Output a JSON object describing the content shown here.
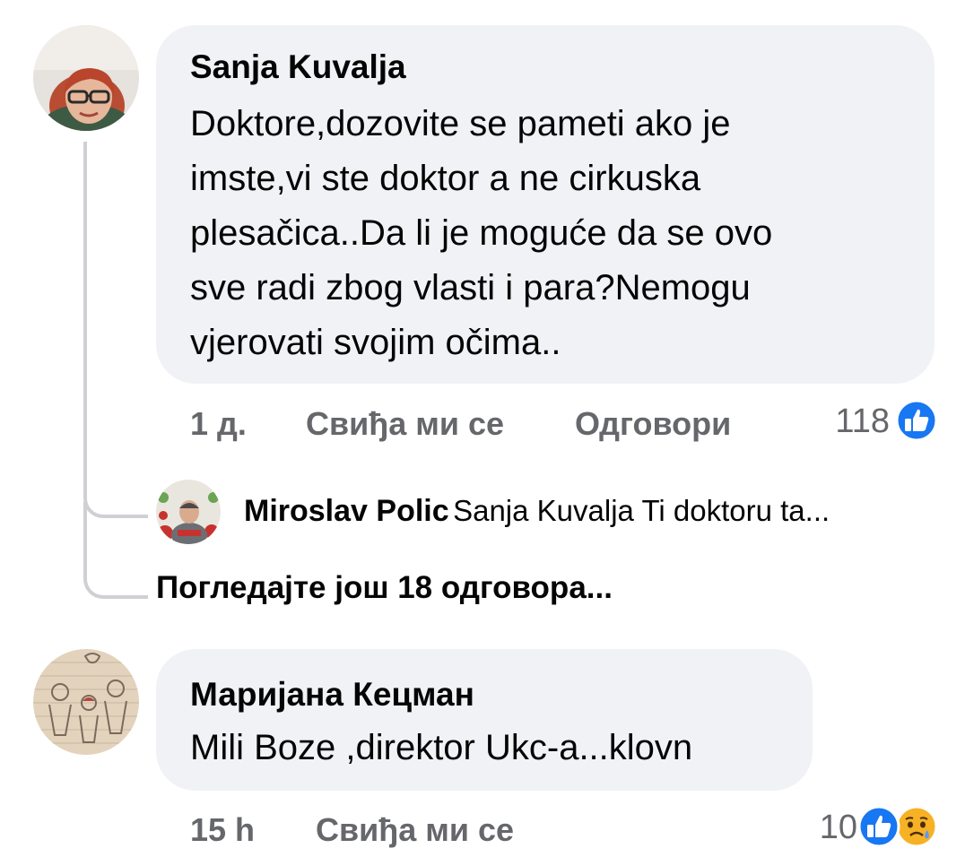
{
  "comments": [
    {
      "author": "Sanja Kuvalja",
      "text_lines": [
        "Doktore,dozovite se pameti ako je",
        "imste,vi ste doktor a ne cirkuska",
        "plesačica..Da li je moguće da se ovo",
        "sve radi zbog vlasti i para?Nemogu",
        "vjerovati svojim očima.."
      ],
      "time": "1 д.",
      "like_label": "Свиђа ми се",
      "reply_label": "Одговори",
      "reaction_count": "118",
      "reactions": [
        "like-icon"
      ]
    },
    {
      "author": "Маријана Кецман",
      "text_lines": [
        "Mili Boze ,direktor Ukc-a...klovn"
      ],
      "time": "15 h",
      "like_label": "Свиђа ми се",
      "reaction_count": "10",
      "reactions": [
        "like-icon",
        "sad-icon"
      ]
    }
  ],
  "reply_preview": {
    "author": "Miroslav Polic",
    "text": "Sanja Kuvalja Ti doktoru ta..."
  },
  "view_more_replies": "Погледајте још 18 одговора...",
  "colors": {
    "bubble": "#f0f2f5",
    "meta_text": "#65676b",
    "like_blue": "#1877f2",
    "sad_yellow": "#f7b125",
    "thread_line": "#ced0d4"
  }
}
